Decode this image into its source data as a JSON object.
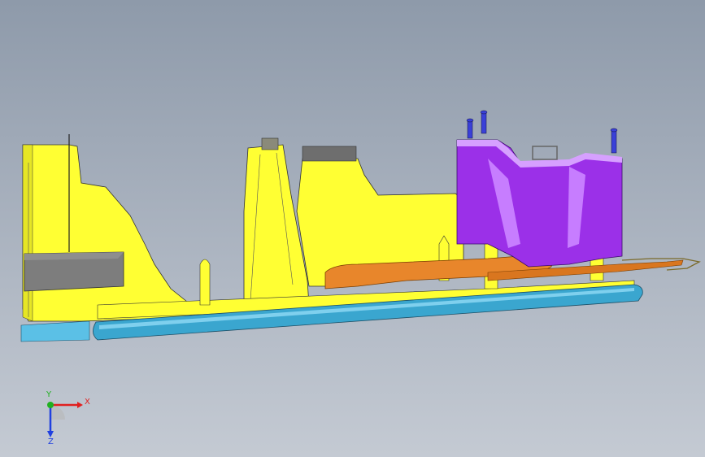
{
  "viewport": {
    "background_top": "#8e9aaa",
    "background_bottom": "#c4cad3"
  },
  "model": {
    "colors": {
      "yellow_body": "#ffff33",
      "yellow_shade": "#e6e625",
      "cyan_rail": "#3aa6cf",
      "cyan_light": "#7fd0ee",
      "orange_part": "#e8862b",
      "purple_bracket": "#9b30e8",
      "purple_light": "#c77dff",
      "grey_block": "#7d7d7d",
      "bolt_blue": "#3a40d8",
      "edge_dark": "#333333"
    }
  },
  "triad": {
    "x_label": "X",
    "y_label": "Y",
    "z_label": "Z",
    "x_color": "#e02020",
    "y_color": "#20b020",
    "z_color": "#2040e0"
  }
}
